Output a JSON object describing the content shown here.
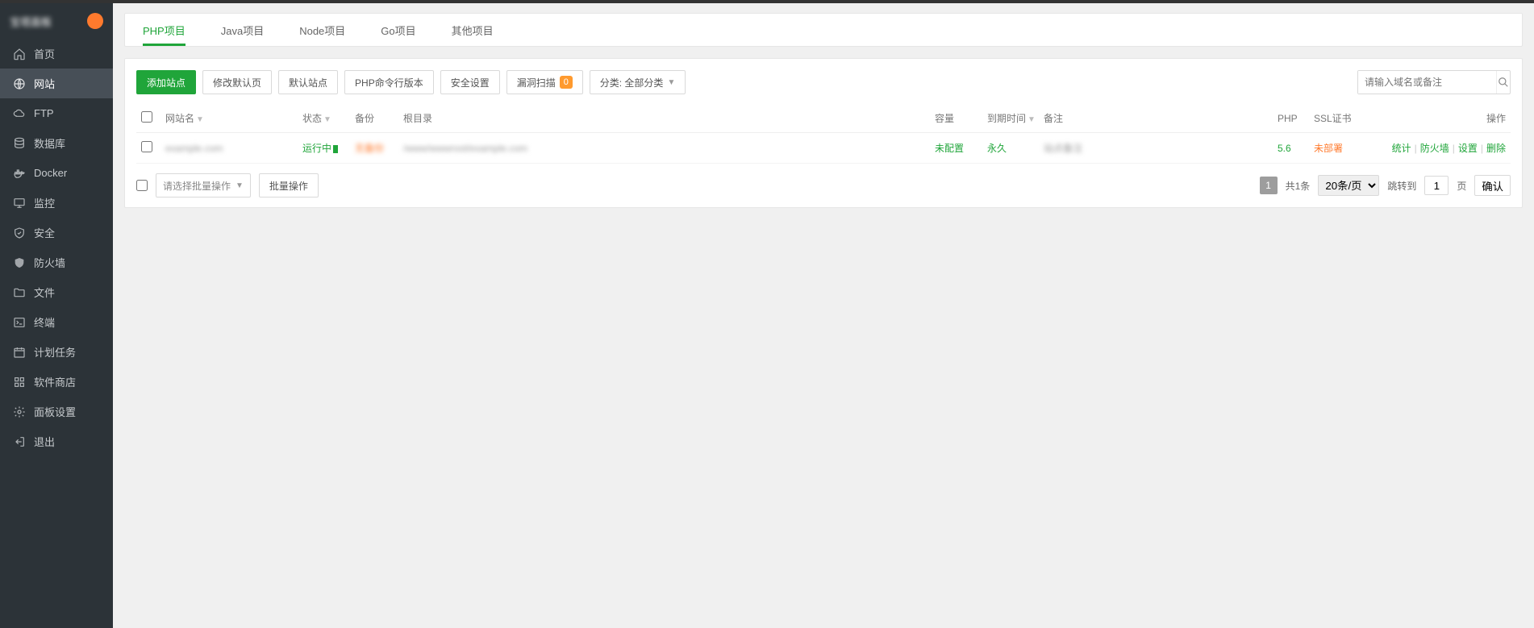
{
  "sidebar": {
    "logo_text": "宝塔面板",
    "items": [
      {
        "label": "首页",
        "icon": "home"
      },
      {
        "label": "网站",
        "icon": "globe",
        "active": true
      },
      {
        "label": "FTP",
        "icon": "cloud"
      },
      {
        "label": "数据库",
        "icon": "database"
      },
      {
        "label": "Docker",
        "icon": "docker"
      },
      {
        "label": "监控",
        "icon": "monitor"
      },
      {
        "label": "安全",
        "icon": "shield"
      },
      {
        "label": "防火墙",
        "icon": "firewall"
      },
      {
        "label": "文件",
        "icon": "folder"
      },
      {
        "label": "终端",
        "icon": "terminal"
      },
      {
        "label": "计划任务",
        "icon": "calendar"
      },
      {
        "label": "软件商店",
        "icon": "apps"
      },
      {
        "label": "面板设置",
        "icon": "settings"
      },
      {
        "label": "退出",
        "icon": "logout"
      }
    ]
  },
  "tabs": [
    {
      "label": "PHP项目",
      "active": true
    },
    {
      "label": "Java项目"
    },
    {
      "label": "Node项目"
    },
    {
      "label": "Go项目"
    },
    {
      "label": "其他项目"
    }
  ],
  "toolbar": {
    "add_site": "添加站点",
    "modify_default": "修改默认页",
    "default_site": "默认站点",
    "php_cli": "PHP命令行版本",
    "security": "安全设置",
    "vuln_scan": "漏洞扫描",
    "vuln_badge": "0",
    "category_label": "分类: 全部分类",
    "search_placeholder": "请输入域名或备注"
  },
  "table": {
    "headers": {
      "name": "网站名",
      "status": "状态",
      "backup": "备份",
      "root": "根目录",
      "capacity": "容量",
      "expire": "到期时间",
      "remark": "备注",
      "php": "PHP",
      "ssl": "SSL证书",
      "action": "操作"
    },
    "rows": [
      {
        "name": "example.com",
        "status": "运行中",
        "backup": "无备份",
        "root": "/www/wwwroot/example.com",
        "capacity": "未配置",
        "expire": "永久",
        "remark": "站点备注",
        "php": "5.6",
        "ssl": "未部署"
      }
    ],
    "actions": {
      "stats": "统计",
      "waf": "防火墙",
      "settings": "设置",
      "delete": "删除"
    }
  },
  "footer": {
    "bulk_placeholder": "请选择批量操作",
    "bulk_btn": "批量操作",
    "total": "共1条",
    "per_page": "20条/页",
    "jump_label": "跳转到",
    "jump_val": "1",
    "page_suffix": "页",
    "confirm": "确认",
    "current_page": "1"
  }
}
